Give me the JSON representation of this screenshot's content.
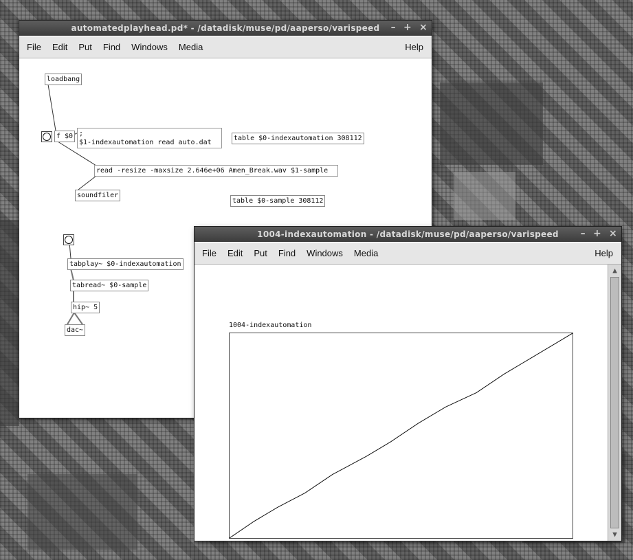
{
  "colors": {
    "titlebar": "#4a4a4a",
    "menubar": "#e6e6e6",
    "canvas": "#ffffff"
  },
  "main_window": {
    "title": "automatedplayhead.pd* - /datadisk/muse/pd/aaperso/varispeed",
    "controls": {
      "minimize": "–",
      "maximize": "+",
      "close": "×"
    },
    "menu": [
      "File",
      "Edit",
      "Put",
      "Find",
      "Windows",
      "Media"
    ],
    "help": "Help",
    "objects": {
      "loadbang": "loadbang",
      "f0": "f $0",
      "msg_auto": ";\n$1-indexautomation read auto.dat",
      "table_index": "table $0-indexautomation 308112",
      "msg_read": "read -resize -maxsize 2.646e+06 Amen_Break.wav $1-sample",
      "soundfiler": "soundfiler",
      "table_sample": "table $0-sample 308112",
      "tabplay": "tabplay~ $0-indexautomation",
      "tabread": "tabread~ $0-sample",
      "hip": "hip~ 5",
      "dac": "dac~"
    }
  },
  "table_window": {
    "title": "1004-indexautomation  - /datadisk/muse/pd/aaperso/varispeed",
    "controls": {
      "minimize": "–",
      "maximize": "+",
      "close": "×"
    },
    "menu": [
      "File",
      "Edit",
      "Put",
      "Find",
      "Windows",
      "Media"
    ],
    "help": "Help",
    "graph_label": "1004-indexautomation",
    "scroll_icons": {
      "up": "up-arrow-icon",
      "down": "down-arrow-icon"
    }
  },
  "chart_data": {
    "type": "line",
    "title": "1004-indexautomation",
    "xlabel": "",
    "ylabel": "",
    "xlim": [
      0,
      1
    ],
    "ylim": [
      0,
      1
    ],
    "grid": false,
    "x": [
      0,
      0.07,
      0.14,
      0.22,
      0.3,
      0.4,
      0.47,
      0.55,
      0.63,
      0.72,
      0.8,
      0.88,
      0.94,
      1.0
    ],
    "y": [
      0,
      0.08,
      0.15,
      0.22,
      0.31,
      0.4,
      0.47,
      0.56,
      0.64,
      0.71,
      0.8,
      0.88,
      0.94,
      1.0
    ]
  }
}
